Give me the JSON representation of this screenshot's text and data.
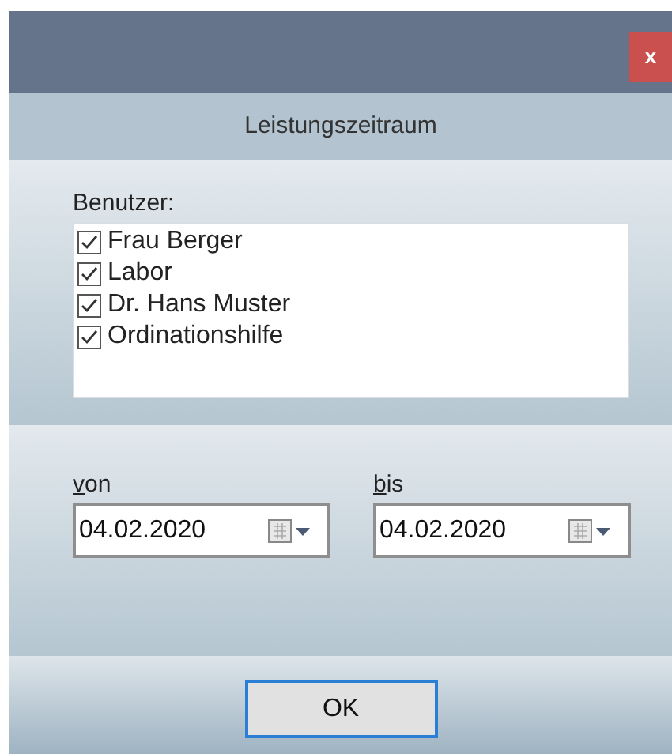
{
  "window": {
    "close_label": "x"
  },
  "header": {
    "title": "Leistungszeitraum"
  },
  "users": {
    "label": "Benutzer:",
    "items": [
      {
        "label": "Frau Berger",
        "checked": true
      },
      {
        "label": "Labor",
        "checked": true
      },
      {
        "label": "Dr. Hans Muster",
        "checked": true
      },
      {
        "label": "Ordinationshilfe",
        "checked": true
      }
    ]
  },
  "dates": [
    {
      "label": "von",
      "mnemonic": true,
      "value": "04.02.2020"
    },
    {
      "label": "bis",
      "mnemonic": true,
      "value": "04.02.2020"
    }
  ],
  "buttons": [
    {
      "label": "OK",
      "focused": true
    }
  ]
}
